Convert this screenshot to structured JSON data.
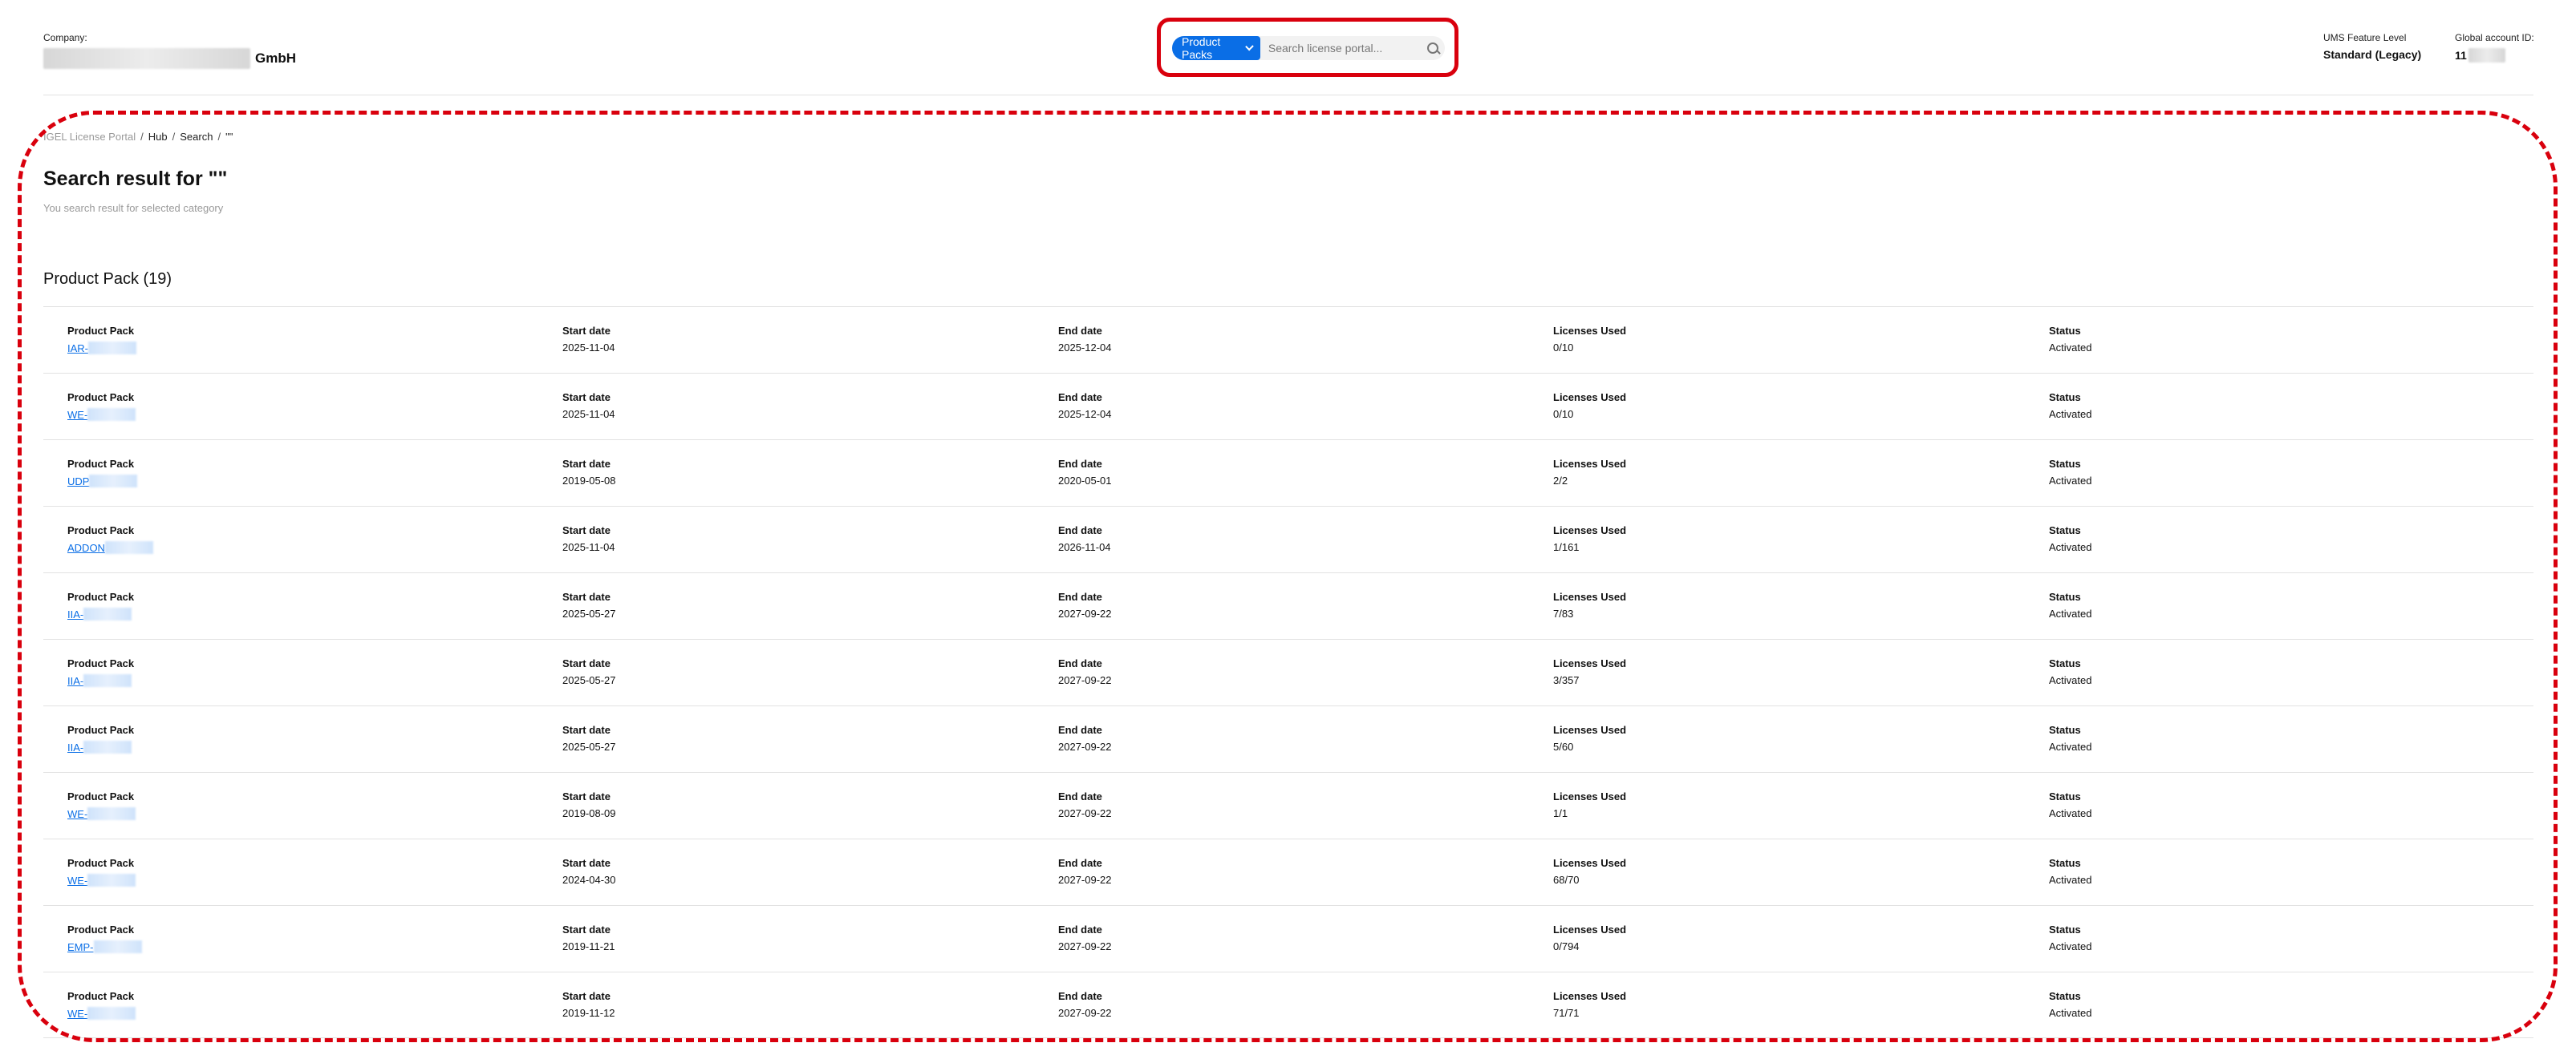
{
  "header": {
    "company_label": "Company:",
    "company_suffix": "GmbH",
    "feature_level_label": "UMS Feature Level",
    "feature_level_value": "Standard (Legacy)",
    "account_label": "Global account ID:",
    "account_value_prefix": "11"
  },
  "search": {
    "category": "Product Packs",
    "placeholder": "Search license portal..."
  },
  "breadcrumb": {
    "root": "IGEL License Portal",
    "sep": "/",
    "hub": "Hub",
    "search": "Search",
    "current": "\"\""
  },
  "page": {
    "title": "Search result for \"\"",
    "subtitle": "You search result for selected category",
    "section_title": "Product Pack (19)"
  },
  "columns": {
    "pack": "Product Pack",
    "start": "Start date",
    "end": "End date",
    "used": "Licenses Used",
    "status": "Status"
  },
  "rows": [
    {
      "pack": "IAR-",
      "start": "2025-11-04",
      "end": "2025-12-04",
      "used": "0/10",
      "status": "Activated"
    },
    {
      "pack": "WE-",
      "start": "2025-11-04",
      "end": "2025-12-04",
      "used": "0/10",
      "status": "Activated"
    },
    {
      "pack": "UDP",
      "start": "2019-05-08",
      "end": "2020-05-01",
      "used": "2/2",
      "status": "Activated"
    },
    {
      "pack": "ADDON",
      "start": "2025-11-04",
      "end": "2026-11-04",
      "used": "1/161",
      "status": "Activated"
    },
    {
      "pack": "IIA-",
      "start": "2025-05-27",
      "end": "2027-09-22",
      "used": "7/83",
      "status": "Activated"
    },
    {
      "pack": "IIA-",
      "start": "2025-05-27",
      "end": "2027-09-22",
      "used": "3/357",
      "status": "Activated"
    },
    {
      "pack": "IIA-",
      "start": "2025-05-27",
      "end": "2027-09-22",
      "used": "5/60",
      "status": "Activated"
    },
    {
      "pack": "WE-",
      "start": "2019-08-09",
      "end": "2027-09-22",
      "used": "1/1",
      "status": "Activated"
    },
    {
      "pack": "WE-",
      "start": "2024-04-30",
      "end": "2027-09-22",
      "used": "68/70",
      "status": "Activated"
    },
    {
      "pack": "EMP-",
      "start": "2019-11-21",
      "end": "2027-09-22",
      "used": "0/794",
      "status": "Activated"
    },
    {
      "pack": "WE-",
      "start": "2019-11-12",
      "end": "2027-09-22",
      "used": "71/71",
      "status": "Activated"
    }
  ]
}
